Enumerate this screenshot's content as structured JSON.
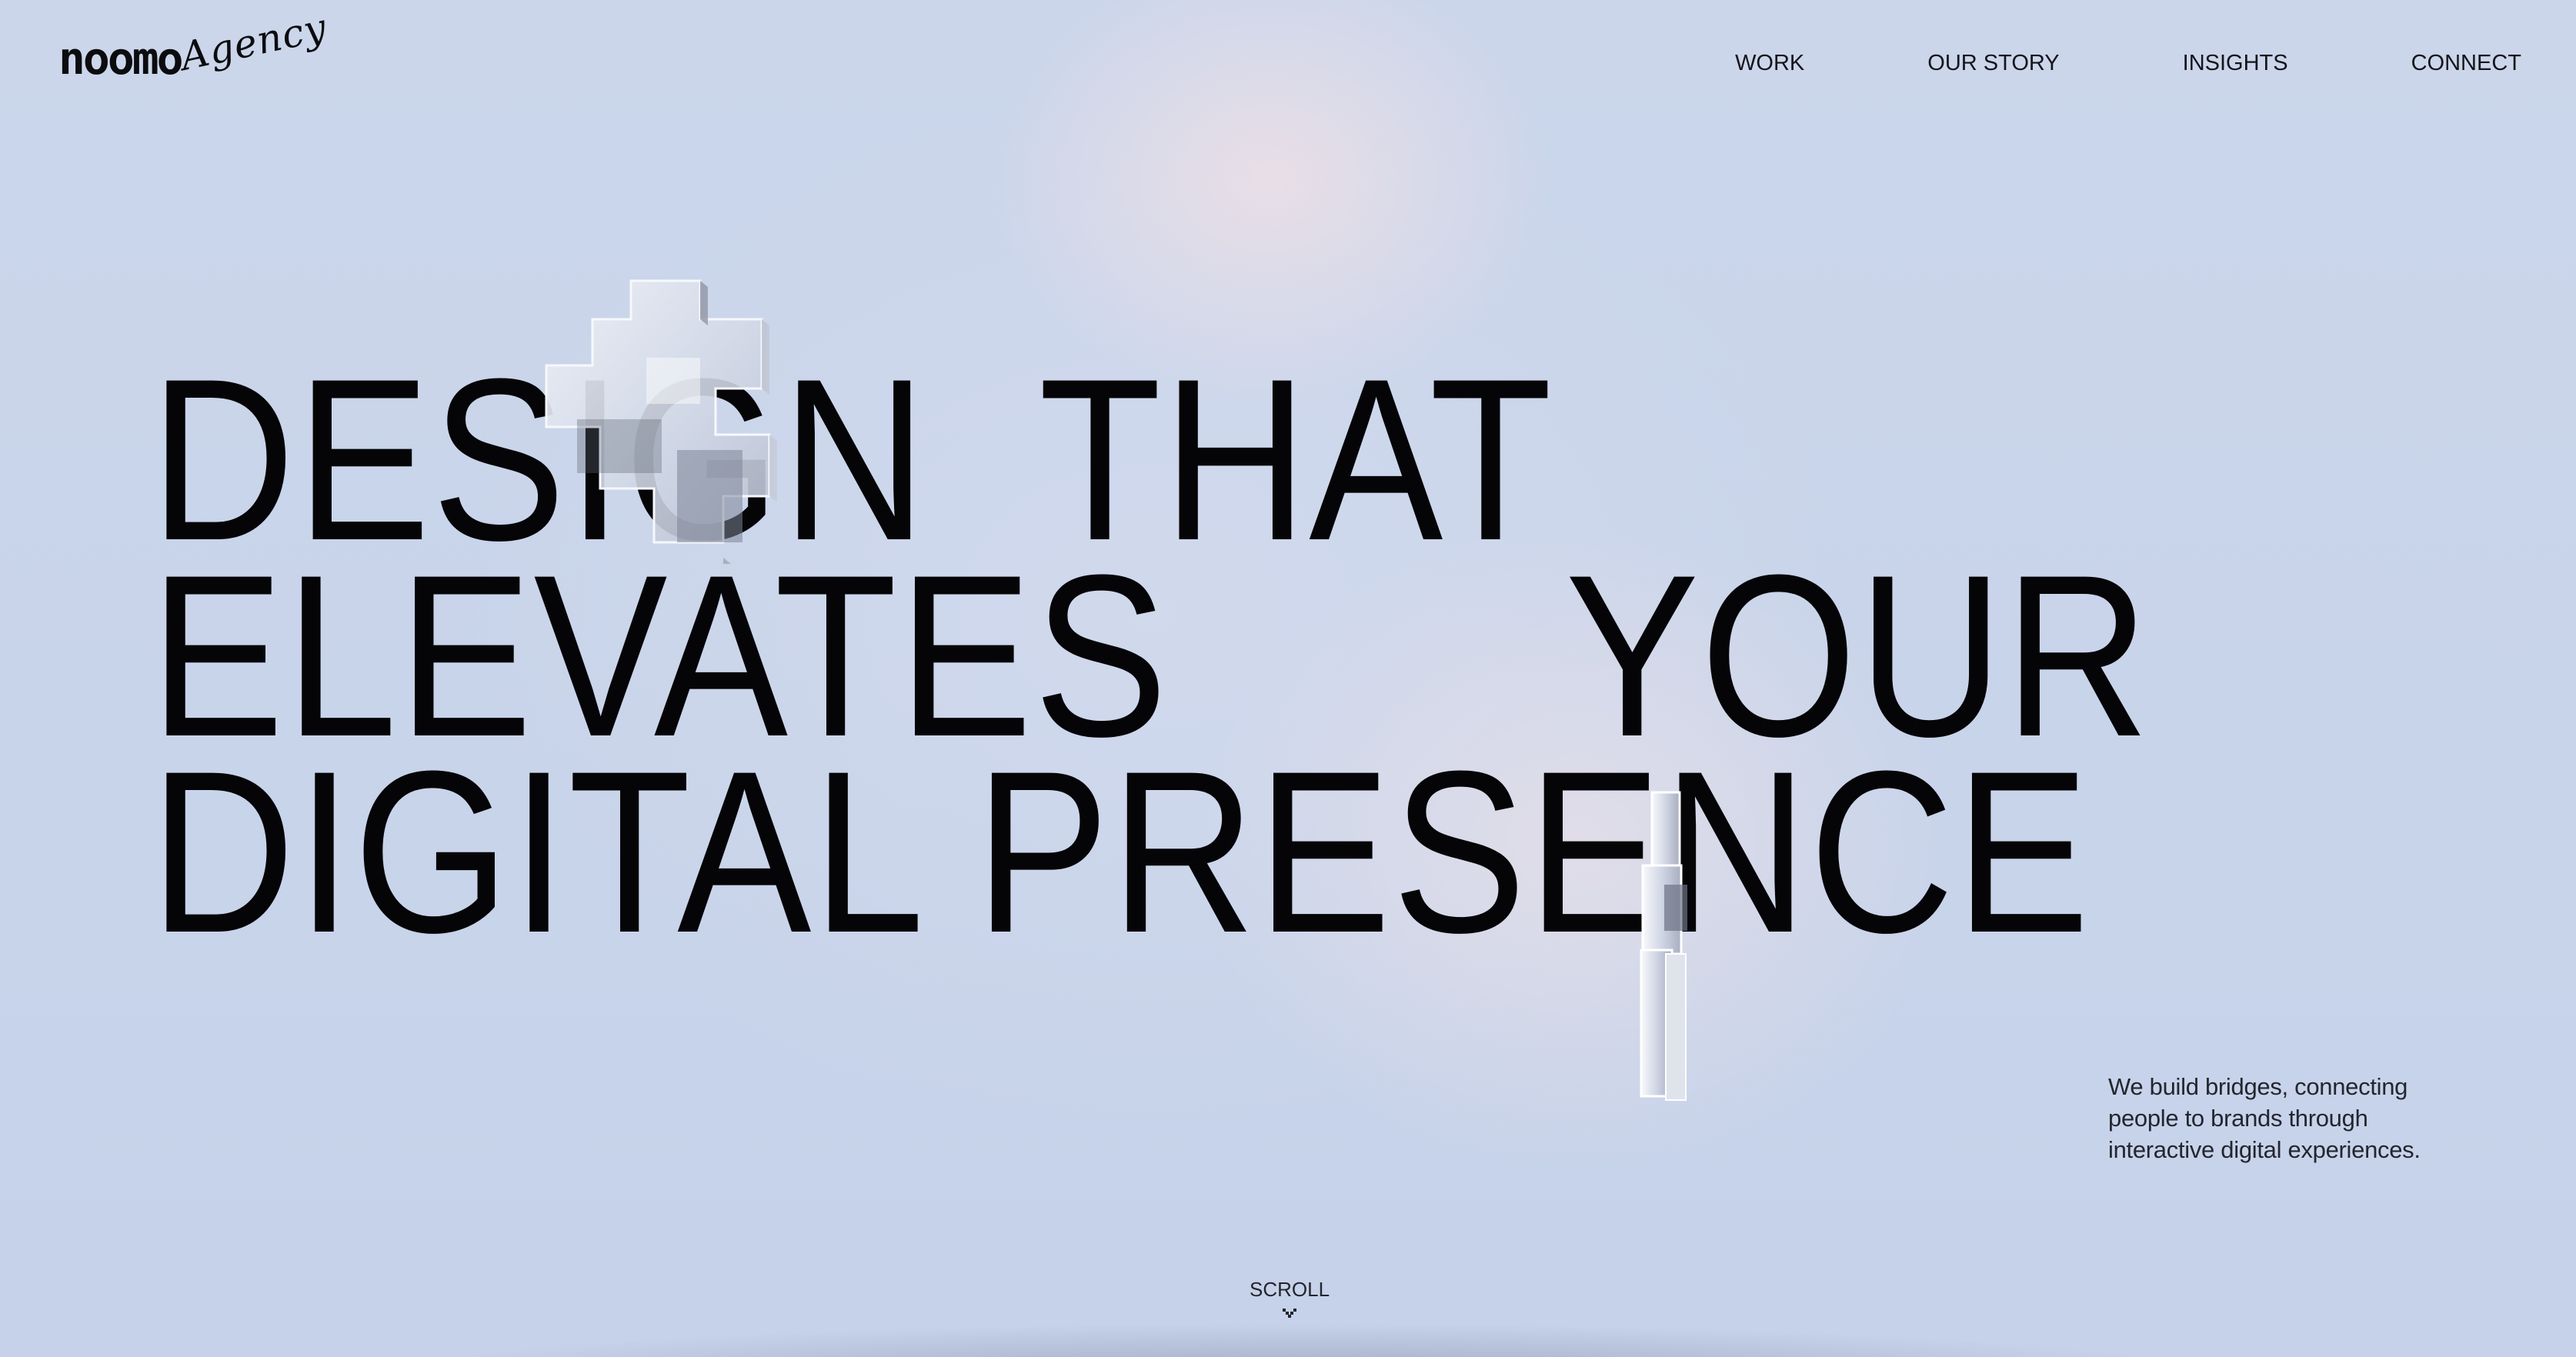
{
  "header": {
    "logo_wordmark": "noomo",
    "logo_script": "Agency",
    "nav": [
      {
        "label": "WORK"
      },
      {
        "label": "OUR STORY"
      },
      {
        "label": "INSIGHTS"
      },
      {
        "label": "CONNECT"
      }
    ]
  },
  "hero": {
    "headline_lines": [
      "DESIGN  THAT",
      "ELEVATES       YOUR",
      "DIGITAL PRESENCE"
    ],
    "tagline": "We build bridges, connecting people to brands through interactive digital experiences."
  },
  "scroll": {
    "label": "SCROLL",
    "icon": "chevron-down-icon"
  },
  "colors": {
    "background": "#c9d5ea",
    "text": "#050507",
    "glow": "#eee0e6"
  }
}
